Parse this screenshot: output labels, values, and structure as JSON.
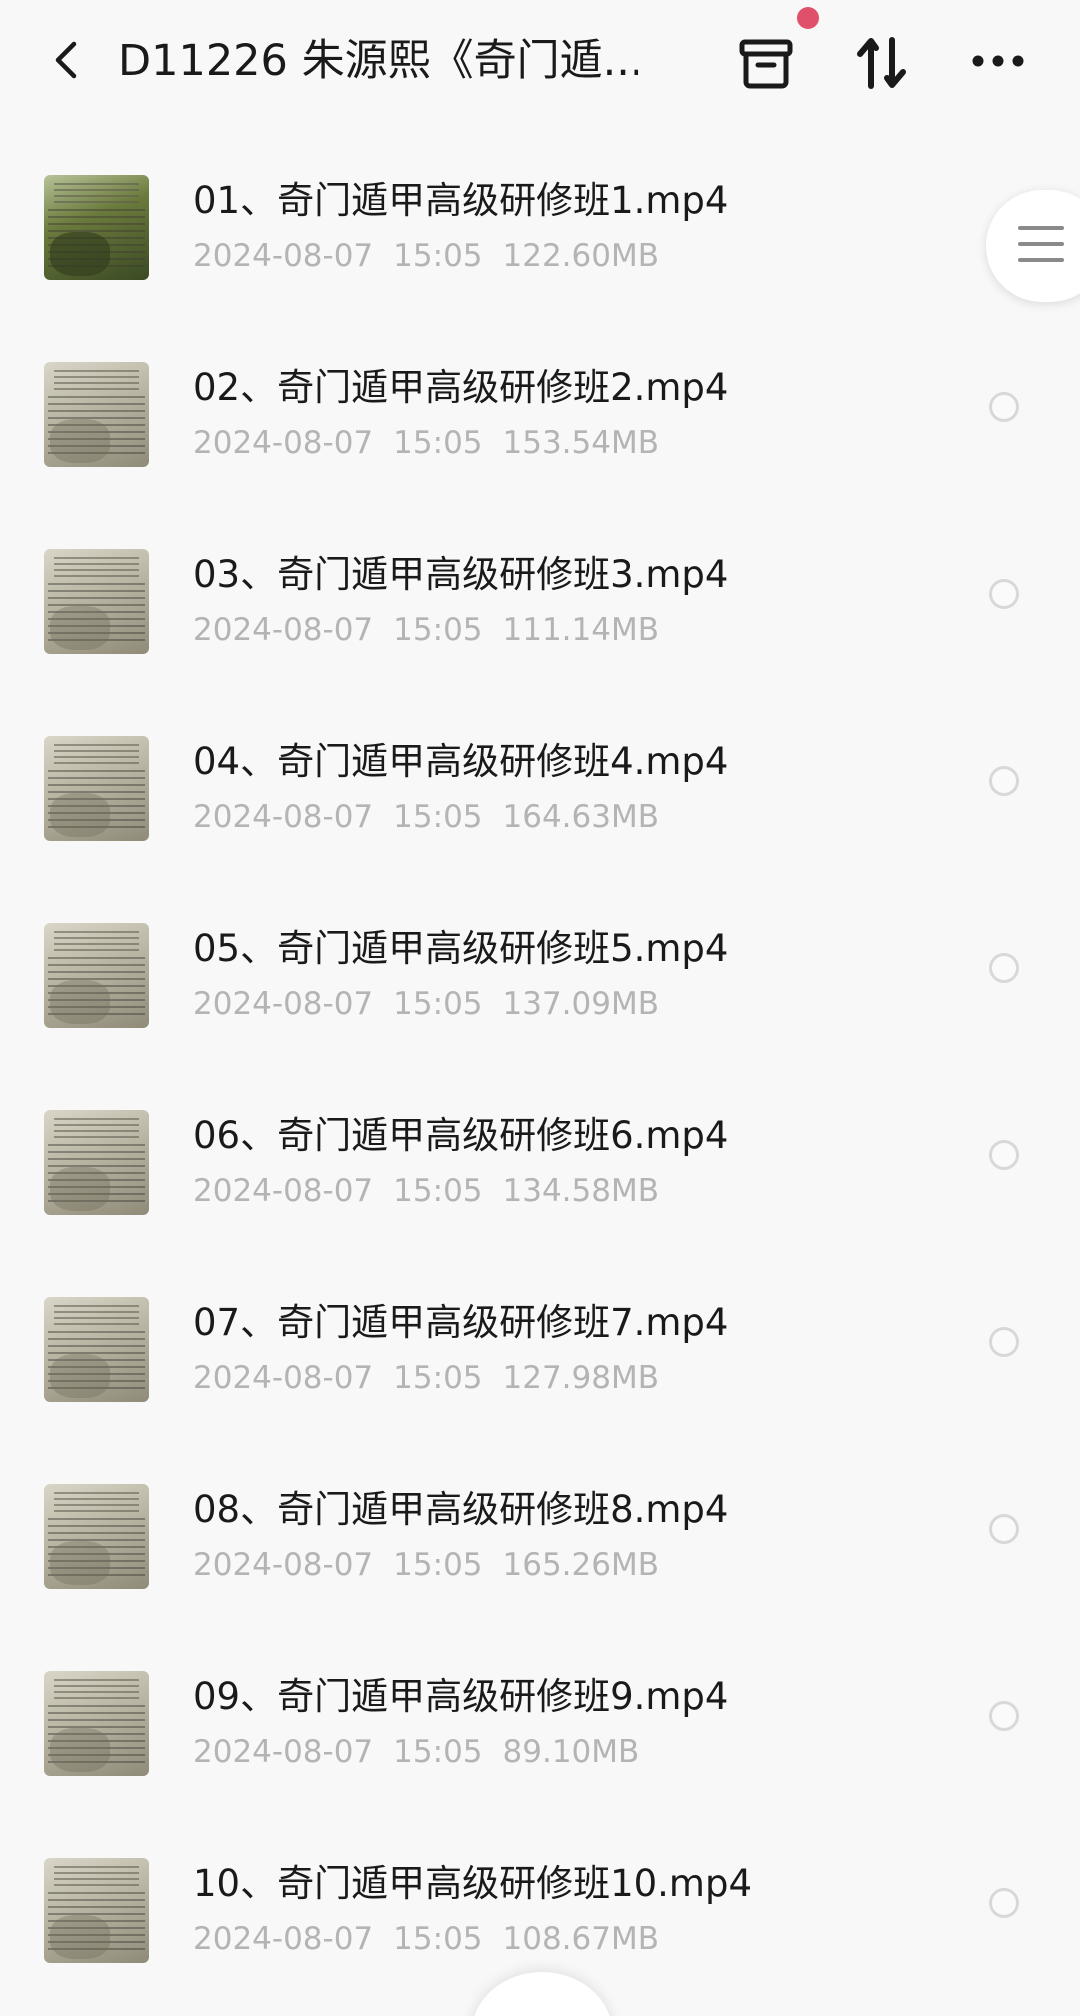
{
  "header": {
    "title": "D11226 朱源熙《奇门遁...",
    "back_icon": "chevron-left-icon",
    "archive_icon": "archive-box-icon",
    "sort_icon": "sort-arrows-icon",
    "more_icon": "more-horizontal-icon",
    "badge_color": "#e0506a"
  },
  "files": [
    {
      "name": "01、奇门遁甲高级研修班1.mp4",
      "date": "2024-08-07",
      "time": "15:05",
      "size": "122.60MB"
    },
    {
      "name": "02、奇门遁甲高级研修班2.mp4",
      "date": "2024-08-07",
      "time": "15:05",
      "size": "153.54MB"
    },
    {
      "name": "03、奇门遁甲高级研修班3.mp4",
      "date": "2024-08-07",
      "time": "15:05",
      "size": "111.14MB"
    },
    {
      "name": "04、奇门遁甲高级研修班4.mp4",
      "date": "2024-08-07",
      "time": "15:05",
      "size": "164.63MB"
    },
    {
      "name": "05、奇门遁甲高级研修班5.mp4",
      "date": "2024-08-07",
      "time": "15:05",
      "size": "137.09MB"
    },
    {
      "name": "06、奇门遁甲高级研修班6.mp4",
      "date": "2024-08-07",
      "time": "15:05",
      "size": "134.58MB"
    },
    {
      "name": "07、奇门遁甲高级研修班7.mp4",
      "date": "2024-08-07",
      "time": "15:05",
      "size": "127.98MB"
    },
    {
      "name": "08、奇门遁甲高级研修班8.mp4",
      "date": "2024-08-07",
      "time": "15:05",
      "size": "165.26MB"
    },
    {
      "name": "09、奇门遁甲高级研修班9.mp4",
      "date": "2024-08-07",
      "time": "15:05",
      "size": "89.10MB"
    },
    {
      "name": "10、奇门遁甲高级研修班10.mp4",
      "date": "2024-08-07",
      "time": "15:05",
      "size": "108.67MB"
    }
  ],
  "side_handle_icon": "menu-lines-icon"
}
